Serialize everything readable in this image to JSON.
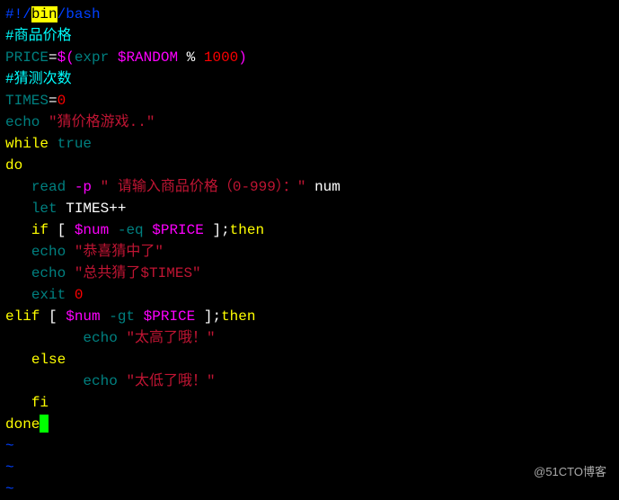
{
  "shebang": {
    "prefix": "#!/",
    "highlighted": "bin",
    "suffix": "/bash"
  },
  "comment1": "#商品价格",
  "price_line": {
    "var": "PRICE",
    "eq": "=",
    "expr_open": "$(",
    "kw": "expr ",
    "rand": "$RANDOM",
    "op": " % ",
    "num": "1000",
    "close": ")"
  },
  "comment2": "#猜测次数",
  "times_line": {
    "var": "TIMES",
    "eq": "=",
    "val": "0"
  },
  "echo1": {
    "cmd": "echo ",
    "str": "\"猜价格游戏..\""
  },
  "while_kw": "while",
  "true_kw": " true",
  "do_kw": "do",
  "read_line": {
    "indent": "   ",
    "cmd": "read ",
    "flag": "-p ",
    "str": "\" 请输入商品价格（0-999）：\"",
    "var": " num"
  },
  "let_line": {
    "indent": "   ",
    "kw": "let",
    "rest": " TIMES++"
  },
  "if1": {
    "indent": "   ",
    "if": "if",
    "open": " [ ",
    "var": "$num",
    "op": " -eq ",
    "var2": "$PRICE",
    "close": " ];",
    "then": "then"
  },
  "echo2": {
    "indent": "   ",
    "cmd": "echo ",
    "str": "\"恭喜猜中了\""
  },
  "echo3": {
    "indent": "   ",
    "cmd": "echo ",
    "str": "\"总共猜了$TIMES\""
  },
  "exit_line": {
    "indent": "   ",
    "cmd": "exit",
    "val": " 0"
  },
  "elif_line": {
    "kw": "elif",
    "open": " [ ",
    "var": "$num",
    "op": " -gt ",
    "var2": "$PRICE",
    "close": " ];",
    "then": "then"
  },
  "echo4": {
    "indent": "         ",
    "cmd": "echo ",
    "str": "\"太高了哦！\""
  },
  "else_line": {
    "indent": "   ",
    "kw": "else"
  },
  "echo5": {
    "indent": "         ",
    "cmd": "echo ",
    "str": "\"太低了哦！\""
  },
  "fi_line": {
    "indent": "   ",
    "kw": "fi"
  },
  "done_kw": "done",
  "tilde": "~",
  "watermark": "@51CTO博客"
}
